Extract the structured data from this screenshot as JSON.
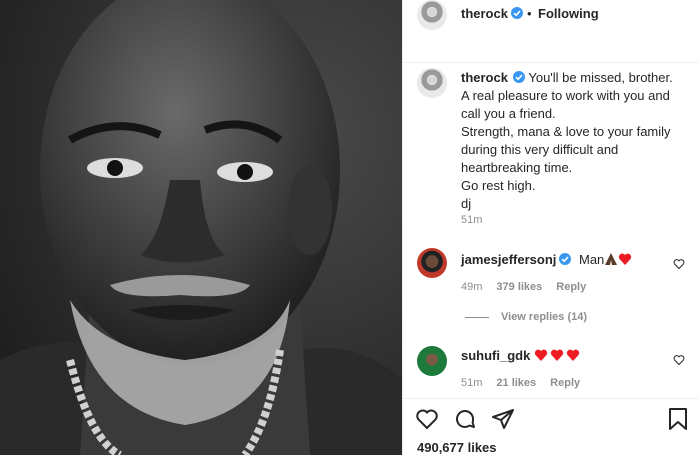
{
  "post": {
    "author": "therock",
    "follow_state": "Following",
    "separator": "•",
    "caption_lines": [
      "You'll be missed, brother.",
      "A real pleasure to work with you and",
      "call you a friend.",
      "Strength, mana & love to your family",
      "during this very difficult and",
      "heartbreaking time.",
      "Go rest high.",
      "dj"
    ],
    "time": "51m",
    "likes": "490,677 likes"
  },
  "comments": [
    {
      "user": "jamesjeffersonj",
      "verified": true,
      "text": "Man",
      "time": "49m",
      "likes": "379 likes",
      "reply": "Reply",
      "view_replies": "View replies (14)"
    },
    {
      "user": "suhufi_gdk",
      "verified": false,
      "text": "",
      "time": "51m",
      "likes": "21 likes",
      "reply": "Reply"
    }
  ],
  "icons": {
    "like": "heart-outline-icon",
    "comment": "comment-bubble-icon",
    "share": "paper-plane-icon",
    "save": "bookmark-icon",
    "verified": "verified-badge-icon",
    "praying_hands": "praying-hands-emoji",
    "red_heart": "red-heart-emoji"
  },
  "colors": {
    "verified_blue": "#3897f0",
    "text": "#262626",
    "muted": "#8e8e8e",
    "heart_red": "#ed1c24"
  }
}
